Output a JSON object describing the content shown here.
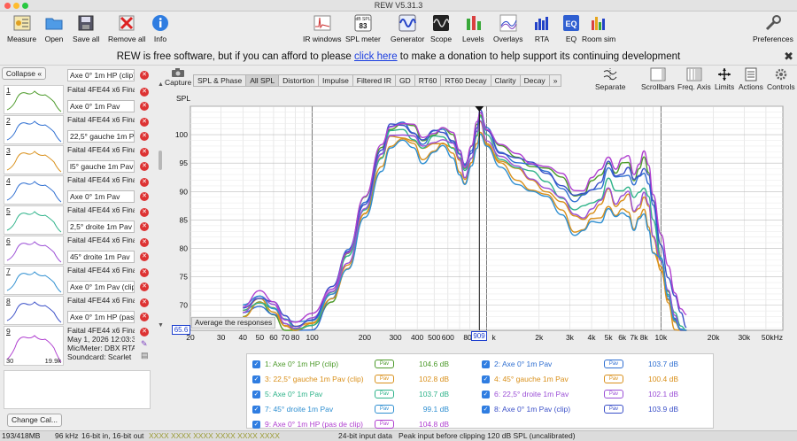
{
  "window": {
    "title": "REW V5.31.3"
  },
  "toolbar": {
    "measure": "Measure",
    "open": "Open",
    "save_all": "Save all",
    "remove_all": "Remove all",
    "info": "Info",
    "ir_windows": "IR windows",
    "spl_meter": "SPL meter",
    "spl_meter_badge": "dB SPL",
    "spl_meter_value": "83",
    "generator": "Generator",
    "scope": "Scope",
    "levels": "Levels",
    "overlays": "Overlays",
    "rta": "RTA",
    "eq": "EQ",
    "eq_badge": "EQ",
    "room_sim": "Room sim",
    "preferences": "Preferences"
  },
  "banner": {
    "before": "REW is free software, but if you can afford to please ",
    "link": "click here",
    "after": " to make a donation to help support its continuing development"
  },
  "left_panel": {
    "collapse": "Collapse",
    "measurements": [
      {
        "num": "",
        "name": "",
        "field": "Axe 0° 1m HP (clip)"
      },
      {
        "num": "1",
        "name": "Faital 4FE44 x6 Fina",
        "field": "Axe 0° 1m Pav"
      },
      {
        "num": "2",
        "name": "Faital 4FE44 x6 Fina",
        "field": "22,5° gauche 1m P"
      },
      {
        "num": "3",
        "name": "Faital 4FE44 x6 Fina",
        "field": "l5° gauche 1m Pav"
      },
      {
        "num": "4",
        "name": "Faital 4FE44 x6 Fina",
        "field": "Axe 0° 1m Pav"
      },
      {
        "num": "5",
        "name": "Faital 4FE44 x6 Fina",
        "field": "2,5° droite 1m Pav"
      },
      {
        "num": "6",
        "name": "Faital 4FE44 x6 Fina",
        "field": "45° droite 1m Pav"
      },
      {
        "num": "7",
        "name": "Faital 4FE44 x6 Fina",
        "field": "Axe 0° 1m Pav (clip"
      },
      {
        "num": "8",
        "name": "Faital 4FE44 x6 Fina",
        "field": "Axe 0° 1m HP (pas"
      }
    ],
    "details": {
      "num": "9",
      "line1": "Faital 4FE44 x6 Fina",
      "line2": "May 1, 2026 12:03:3",
      "line3": "Mic/Meter: DBX RTA",
      "line4": "Soundcard: Scarlet",
      "thumb_left": "30",
      "thumb_right": "19.9k"
    },
    "change_cal": "Change Cal..."
  },
  "graph_tabs": [
    "SPL & Phase",
    "All SPL",
    "Distortion",
    "Impulse",
    "Filtered IR",
    "GD",
    "RT60",
    "RT60 Decay",
    "Clarity",
    "Decay",
    "»"
  ],
  "graph_tools": {
    "capture": "Capture",
    "separate": "Separate",
    "scrollbars": "Scrollbars",
    "freq_axis": "Freq. Axis",
    "limits": "Limits",
    "actions": "Actions",
    "controls": "Controls"
  },
  "avg_tip": "Average the responses",
  "cursor_freq": "909",
  "y_min_label": "65.6",
  "chart_data": {
    "type": "line",
    "xlabel": "",
    "ylabel": "SPL",
    "x_scale": "log",
    "xlim": [
      20,
      50000
    ],
    "ylim": [
      65.6,
      105
    ],
    "yticks": [
      70,
      75,
      80,
      85,
      90,
      95,
      100
    ],
    "xticks": [
      {
        "v": 20,
        "t": "20"
      },
      {
        "v": 30,
        "t": "30"
      },
      {
        "v": 40,
        "t": "40"
      },
      {
        "v": 50,
        "t": "50"
      },
      {
        "v": 60,
        "t": "60"
      },
      {
        "v": 70,
        "t": "70"
      },
      {
        "v": 80,
        "t": "80"
      },
      {
        "v": 100,
        "t": "100"
      },
      {
        "v": 200,
        "t": "200"
      },
      {
        "v": 300,
        "t": "300"
      },
      {
        "v": 400,
        "t": "400"
      },
      {
        "v": 500,
        "t": "500"
      },
      {
        "v": 600,
        "t": "600"
      },
      {
        "v": 800,
        "t": "800"
      },
      {
        "v": 2000,
        "t": "2k"
      },
      {
        "v": 3000,
        "t": "3k"
      },
      {
        "v": 4000,
        "t": "4k"
      },
      {
        "v": 5000,
        "t": "5k"
      },
      {
        "v": 6000,
        "t": "6k"
      },
      {
        "v": 7000,
        "t": "7k"
      },
      {
        "v": 8000,
        "t": "8k"
      },
      {
        "v": 10000,
        "t": "10k"
      },
      {
        "v": 20000,
        "t": "20k"
      },
      {
        "v": 30000,
        "t": "30k"
      },
      {
        "v": 50000,
        "t": "50kHz"
      }
    ],
    "cursor": 909,
    "base_curve": {
      "x": [
        40,
        50,
        60,
        70,
        80,
        100,
        130,
        160,
        200,
        250,
        280,
        330,
        380,
        430,
        500,
        560,
        640,
        700,
        750,
        820,
        880,
        920,
        1000,
        1200,
        1500,
        1800,
        2200,
        2700,
        3200,
        3600,
        4000,
        4500,
        5000,
        5500,
        6000,
        6500,
        7000,
        7500,
        8000,
        8500,
        9000,
        10000,
        11000,
        12000,
        13000,
        14000
      ],
      "y": [
        69,
        71,
        69.5,
        67,
        66,
        67,
        72,
        79,
        88,
        97,
        101,
        101.5,
        100.5,
        98.5,
        100,
        100.5,
        99,
        96.5,
        94,
        97,
        101,
        103.5,
        100.5,
        97,
        95.5,
        94.5,
        93.5,
        91.5,
        89,
        89.5,
        91,
        92,
        95,
        93,
        94,
        94.5,
        92,
        93.5,
        95,
        93,
        88.5,
        80,
        74,
        70,
        67.5,
        65.6
      ]
    },
    "series": [
      {
        "name": "1: Axe 0° 1m HP (clip)",
        "color": "#4c9a2a",
        "level": "104.6 dB",
        "offset": 0.5,
        "hf": 0
      },
      {
        "name": "2: Axe 0° 1m Pav",
        "color": "#2f6fd1",
        "level": "103.7 dB",
        "offset": 0.2,
        "hf": -1
      },
      {
        "name": "3: 22,5° gauche 1m Pav (clip)",
        "color": "#d9901b",
        "level": "102.8 dB",
        "offset": -1.5,
        "hf": -3
      },
      {
        "name": "4: 45° gauche 1m Pav",
        "color": "#d9901b",
        "level": "100.4 dB",
        "offset": -2.5,
        "hf": -4
      },
      {
        "name": "5: Axe 0° 1m Pav",
        "color": "#2fb38a",
        "level": "103.7 dB",
        "offset": -0.8,
        "hf": -2
      },
      {
        "name": "6: 22,5° droite 1m Pav",
        "color": "#9b4fd6",
        "level": "102.1 dB",
        "offset": -1.0,
        "hf": -3
      },
      {
        "name": "7: 45° droite 1m Pav",
        "color": "#2f8fd1",
        "level": "99.1 dB",
        "offset": -3.0,
        "hf": -4
      },
      {
        "name": "8: Axe 0° 1m Pav (clip)",
        "color": "#3b50c8",
        "level": "103.9 dB",
        "offset": 0.3,
        "hf": -0.5
      },
      {
        "name": "9: Axe 0° 1m HP (pas de clip)",
        "color": "#b040d0",
        "level": "104.8 dB",
        "offset": 0.8,
        "hf": 0.5
      }
    ]
  },
  "legend_chip": "Pav",
  "status": {
    "memory": "193/418MB",
    "rate": "96 kHz",
    "bits": "16-bit in, 16-bit out",
    "xx": "XXXX XXXX   XXXX XXXX   XXXX XXXX",
    "input": "24-bit input data",
    "peak": "Peak input before clipping 120 dB SPL (uncalibrated)"
  }
}
